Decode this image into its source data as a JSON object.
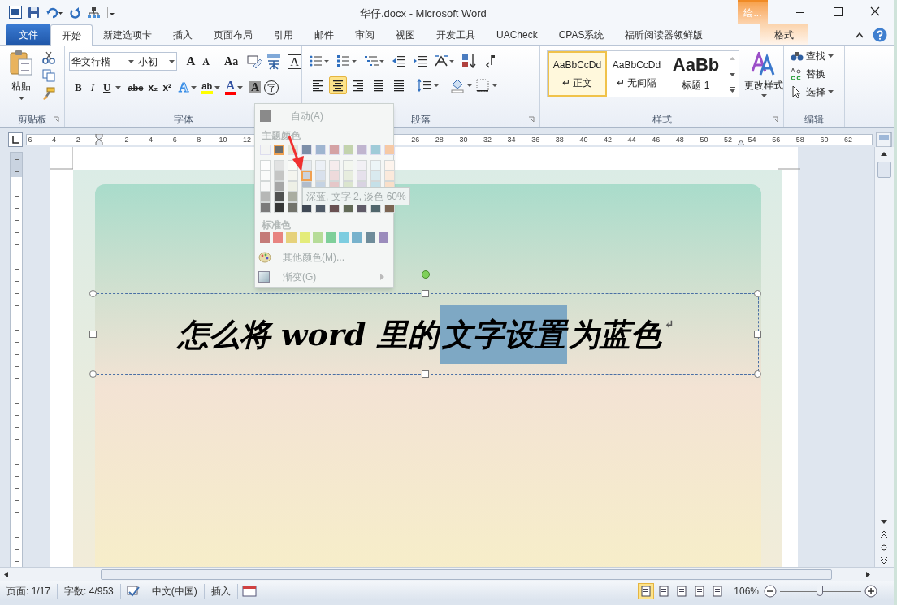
{
  "title_bar": {
    "title": "华仔.docx - Microsoft Word",
    "contextual_group": "绘..."
  },
  "tabs": [
    {
      "label": "文件",
      "kind": "file",
      "selected": false
    },
    {
      "label": "开始",
      "kind": "normal",
      "selected": true
    },
    {
      "label": "新建选项卡",
      "kind": "normal",
      "selected": false
    },
    {
      "label": "插入",
      "kind": "normal",
      "selected": false
    },
    {
      "label": "页面布局",
      "kind": "normal",
      "selected": false
    },
    {
      "label": "引用",
      "kind": "normal",
      "selected": false
    },
    {
      "label": "邮件",
      "kind": "normal",
      "selected": false
    },
    {
      "label": "审阅",
      "kind": "normal",
      "selected": false
    },
    {
      "label": "视图",
      "kind": "normal",
      "selected": false
    },
    {
      "label": "开发工具",
      "kind": "normal",
      "selected": false
    },
    {
      "label": "UACheck",
      "kind": "normal",
      "selected": false
    },
    {
      "label": "CPAS系统",
      "kind": "normal",
      "selected": false
    },
    {
      "label": "福昕阅读器领鲜版",
      "kind": "normal",
      "selected": false
    },
    {
      "label": "格式",
      "kind": "contextual",
      "selected": false
    }
  ],
  "ribbon": {
    "clipboard": {
      "paste": "粘贴",
      "label": "剪贴板"
    },
    "font": {
      "name": "华文行楷",
      "size": "小初",
      "label": "字体",
      "row1": [
        {
          "label": "A",
          "kind": "grow"
        },
        {
          "label": "A",
          "kind": "shrink"
        },
        {
          "label": "Aa",
          "kind": "case"
        },
        {
          "label": "A",
          "kind": "border"
        }
      ],
      "row2": [
        {
          "label": "B",
          "kind": "bold"
        },
        {
          "label": "I",
          "kind": "italic"
        },
        {
          "label": "U",
          "kind": "underline"
        },
        {
          "label": "abc",
          "kind": "strike"
        },
        {
          "label": "x₂",
          "kind": "sub"
        },
        {
          "label": "x²",
          "kind": "super"
        },
        {
          "label": "A",
          "kind": "effects"
        },
        {
          "label": "ab",
          "kind": "highlight"
        },
        {
          "label": "A",
          "kind": "color"
        },
        {
          "label": "A",
          "kind": "shading"
        },
        {
          "label": "字",
          "kind": "enclose"
        }
      ]
    },
    "paragraph": {
      "label": "段落",
      "alignments": [
        {
          "selected": false
        },
        {
          "selected": true
        },
        {
          "selected": false
        },
        {
          "selected": false
        },
        {
          "selected": false
        }
      ]
    },
    "styles": {
      "label": "样式",
      "items": [
        {
          "sample": "AaBbCcDd",
          "name": "↵ 正文",
          "kind": "normal",
          "selected": true
        },
        {
          "sample": "AaBbCcDd",
          "name": "↵ 无间隔",
          "kind": "normal",
          "selected": false
        },
        {
          "sample": "AaBb",
          "name": "标题 1",
          "kind": "heading",
          "selected": false
        }
      ],
      "change_styles": "更改样式"
    },
    "editing": {
      "label": "编辑",
      "items": [
        "查找",
        "替换",
        "选择"
      ]
    }
  },
  "ruler": {
    "left_labels": [
      "6",
      "4",
      "2"
    ],
    "right_labels": [
      "2",
      "4",
      "6",
      "8",
      "10",
      "12"
    ],
    "far_labels": [
      "26",
      "28",
      "30",
      "32",
      "34",
      "36",
      "38",
      "40",
      "42",
      "44",
      "46",
      "48",
      "50",
      "52",
      "54",
      "56",
      "58",
      "60",
      "62"
    ]
  },
  "document": {
    "heading": [
      {
        "text": "怎么将 word 里的",
        "selected": false
      },
      {
        "text": "文字设置",
        "selected": true
      },
      {
        "text": "为蓝色",
        "selected": false
      },
      {
        "text": "↵",
        "selected": false
      }
    ]
  },
  "color_menu": {
    "automatic": "自动(A)",
    "theme_label": "主题颜色",
    "theme_colors": [
      {
        "color": "#f3f4f3",
        "selected": false,
        "tint_hovered": false
      },
      {
        "color": "#6b6d6c",
        "selected": true,
        "tint_hovered": false
      },
      {
        "color": "#e3e6d6",
        "selected": false,
        "tint_hovered": false
      },
      {
        "color": "#7d8fa8",
        "selected": false,
        "tint_hovered": true
      },
      {
        "color": "#9fb5d0",
        "selected": false,
        "tint_hovered": false
      },
      {
        "color": "#d4a2a4",
        "selected": false,
        "tint_hovered": false
      },
      {
        "color": "#c3d3ad",
        "selected": false,
        "tint_hovered": false
      },
      {
        "color": "#c0b5cf",
        "selected": false,
        "tint_hovered": false
      },
      {
        "color": "#9fcbd8",
        "selected": false,
        "tint_hovered": false
      },
      {
        "color": "#f6c9a5",
        "selected": false,
        "tint_hovered": false
      }
    ],
    "standard_label": "标准色",
    "standard_colors": [
      {
        "color": "#c47b78"
      },
      {
        "color": "#e88480"
      },
      {
        "color": "#e6d27c"
      },
      {
        "color": "#e4ec7a"
      },
      {
        "color": "#b6dc98"
      },
      {
        "color": "#7fcf9a"
      },
      {
        "color": "#7dcde0"
      },
      {
        "color": "#77b2cc"
      },
      {
        "color": "#6f8c9a"
      },
      {
        "color": "#9b8cbc"
      }
    ],
    "more_colors": "其他颜色(M)...",
    "gradient": "渐变(G)",
    "tooltip": "深蓝, 文字 2, 淡色 60%"
  },
  "status_bar": {
    "page": "页面: 1/17",
    "words": "字数: 4/953",
    "language": "中文(中国)",
    "mode": "插入",
    "zoom": "106%",
    "zoom_slider": {
      "level": 0.49
    },
    "views": [
      {
        "selected": true
      },
      {
        "selected": false
      },
      {
        "selected": false
      },
      {
        "selected": false
      },
      {
        "selected": false
      }
    ]
  }
}
